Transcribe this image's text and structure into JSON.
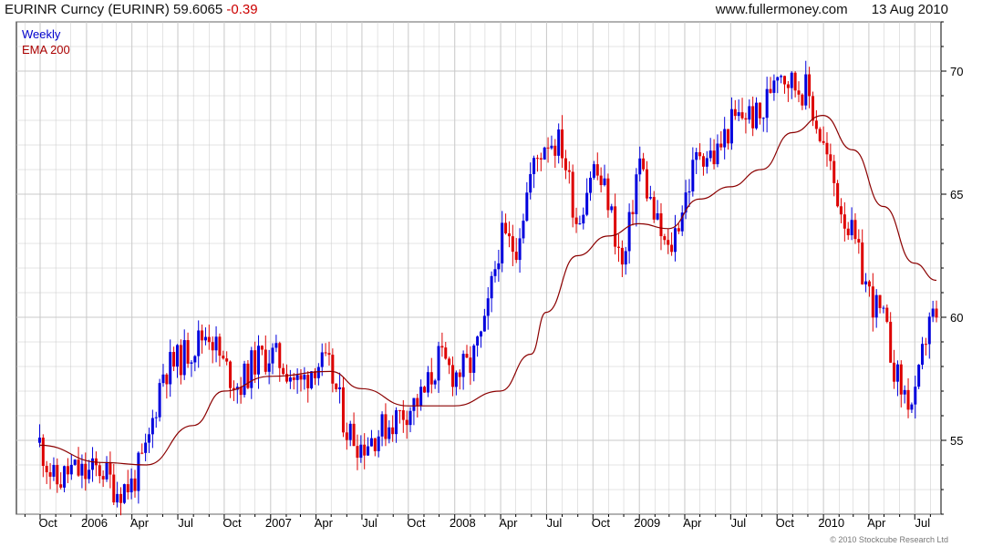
{
  "header": {
    "symbol": "EURINR Curncy (EURINR)",
    "last": "59.6065",
    "change": "-0.39",
    "site": "www.fullermoney.com",
    "date": "13 Aug 2010"
  },
  "legend": {
    "line1": "Weekly",
    "line2": "EMA 200"
  },
  "copyright": "© 2010 Stockcube Research Ltd",
  "colors": {
    "up": "#0000dd",
    "down": "#dd0000",
    "ema": "#8b0000",
    "grid": "#c8c8c8"
  },
  "chart_data": {
    "type": "candlestick",
    "frequency": "Weekly",
    "ylim": [
      52,
      72
    ],
    "y_ticks": [
      55,
      60,
      65,
      70
    ],
    "x_ticks": [
      "Oct",
      "2006",
      "Apr",
      "Jul",
      "Oct",
      "2007",
      "Apr",
      "Jul",
      "Oct",
      "2008",
      "Apr",
      "Jul",
      "Oct",
      "2009",
      "Apr",
      "Jul",
      "Oct",
      "2010",
      "Apr",
      "Jul"
    ],
    "close_series": {
      "name": "EURINR",
      "points": [
        [
          "2005-09-30",
          54.9
        ],
        [
          "2005-10-31",
          53.2
        ],
        [
          "2005-11-30",
          53.8
        ],
        [
          "2005-12-31",
          53.6
        ],
        [
          "2006-01-31",
          53.9
        ],
        [
          "2006-02-28",
          53.0
        ],
        [
          "2006-03-31",
          53.2
        ],
        [
          "2006-04-30",
          54.5
        ],
        [
          "2006-05-31",
          57.8
        ],
        [
          "2006-06-30",
          58.2
        ],
        [
          "2006-07-31",
          58.8
        ],
        [
          "2006-08-31",
          59.5
        ],
        [
          "2006-09-30",
          58.0
        ],
        [
          "2006-10-31",
          57.2
        ],
        [
          "2006-11-30",
          58.2
        ],
        [
          "2006-12-31",
          58.5
        ],
        [
          "2007-01-31",
          58.0
        ],
        [
          "2007-02-28",
          57.2
        ],
        [
          "2007-03-31",
          58.2
        ],
        [
          "2007-04-30",
          57.8
        ],
        [
          "2007-05-31",
          55.5
        ],
        [
          "2007-06-30",
          54.8
        ],
        [
          "2007-07-31",
          55.3
        ],
        [
          "2007-08-31",
          55.8
        ],
        [
          "2007-09-30",
          56.3
        ],
        [
          "2007-10-31",
          56.8
        ],
        [
          "2007-11-30",
          58.3
        ],
        [
          "2007-12-31",
          57.7
        ],
        [
          "2008-01-31",
          58.0
        ],
        [
          "2008-02-29",
          59.5
        ],
        [
          "2008-03-31",
          63.2
        ],
        [
          "2008-04-30",
          62.8
        ],
        [
          "2008-05-31",
          65.8
        ],
        [
          "2008-06-30",
          67.3
        ],
        [
          "2008-07-31",
          67.0
        ],
        [
          "2008-08-31",
          63.8
        ],
        [
          "2008-09-30",
          66.2
        ],
        [
          "2008-10-31",
          64.8
        ],
        [
          "2008-11-30",
          61.8
        ],
        [
          "2008-12-31",
          66.5
        ],
        [
          "2009-01-31",
          64.0
        ],
        [
          "2009-02-28",
          62.5
        ],
        [
          "2009-03-31",
          64.8
        ],
        [
          "2009-04-30",
          66.8
        ],
        [
          "2009-05-31",
          66.5
        ],
        [
          "2009-06-30",
          67.8
        ],
        [
          "2009-07-31",
          68.3
        ],
        [
          "2009-08-31",
          68.0
        ],
        [
          "2009-09-30",
          70.3
        ],
        [
          "2009-10-31",
          69.5
        ],
        [
          "2009-11-30",
          69.2
        ],
        [
          "2009-12-31",
          67.0
        ],
        [
          "2010-01-31",
          64.8
        ],
        [
          "2010-02-28",
          63.2
        ],
        [
          "2010-03-31",
          61.0
        ],
        [
          "2010-04-30",
          59.8
        ],
        [
          "2010-05-31",
          57.2
        ],
        [
          "2010-06-30",
          56.3
        ],
        [
          "2010-07-31",
          60.3
        ],
        [
          "2010-08-13",
          59.6065
        ]
      ]
    },
    "ema_series": {
      "name": "EMA 200",
      "points": [
        [
          "2005-09-30",
          54.8
        ],
        [
          "2006-01-31",
          54.1
        ],
        [
          "2006-04-30",
          54.0
        ],
        [
          "2006-07-31",
          55.6
        ],
        [
          "2006-09-30",
          57.0
        ],
        [
          "2006-12-31",
          57.6
        ],
        [
          "2007-04-30",
          57.8
        ],
        [
          "2007-06-30",
          57.1
        ],
        [
          "2007-09-30",
          56.4
        ],
        [
          "2007-12-31",
          56.4
        ],
        [
          "2008-03-31",
          57.0
        ],
        [
          "2008-05-31",
          58.5
        ],
        [
          "2008-06-30",
          60.2
        ],
        [
          "2008-08-31",
          62.5
        ],
        [
          "2008-10-31",
          63.3
        ],
        [
          "2008-12-31",
          63.8
        ],
        [
          "2009-02-28",
          63.6
        ],
        [
          "2009-04-30",
          64.8
        ],
        [
          "2009-06-30",
          65.3
        ],
        [
          "2009-08-31",
          66.0
        ],
        [
          "2009-10-31",
          67.5
        ],
        [
          "2009-12-31",
          68.2
        ],
        [
          "2010-02-28",
          66.8
        ],
        [
          "2010-04-30",
          64.5
        ],
        [
          "2010-06-30",
          62.2
        ],
        [
          "2010-08-13",
          61.5
        ]
      ]
    }
  }
}
